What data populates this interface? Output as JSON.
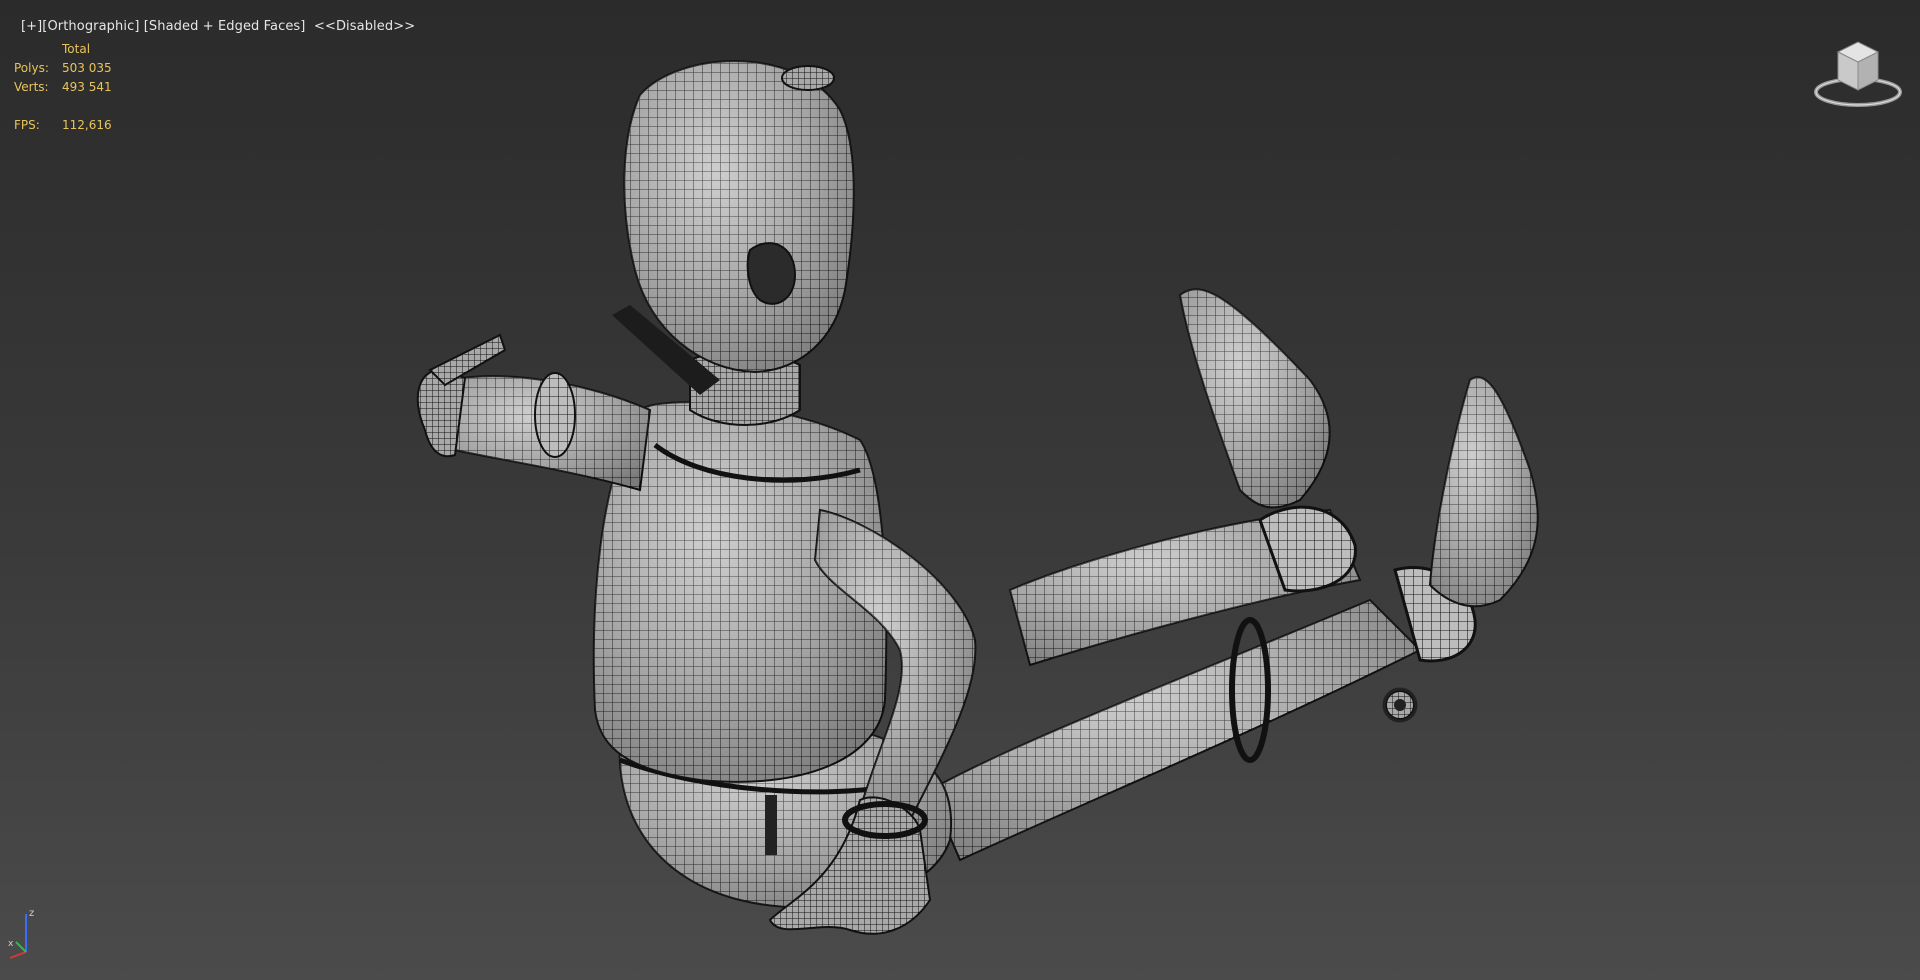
{
  "viewport": {
    "label": {
      "plus": "[+]",
      "view": "[Orthographic]",
      "shading": "[Shaded + Edged Faces]",
      "disabled": "<<Disabled>>"
    }
  },
  "stats": {
    "header": "Total",
    "polys_label": "Polys:",
    "polys_value": "503 035",
    "verts_label": "Verts:",
    "verts_value": "493 541",
    "fps_label": "FPS:",
    "fps_value": "112,616"
  },
  "axis": {
    "z": "z",
    "x": "x"
  },
  "colors": {
    "stats_text": "#e8c45a",
    "label_text": "#e6e6e6",
    "mesh_fill": "#b9b9b9",
    "mesh_wire": "#1a1a1a"
  }
}
